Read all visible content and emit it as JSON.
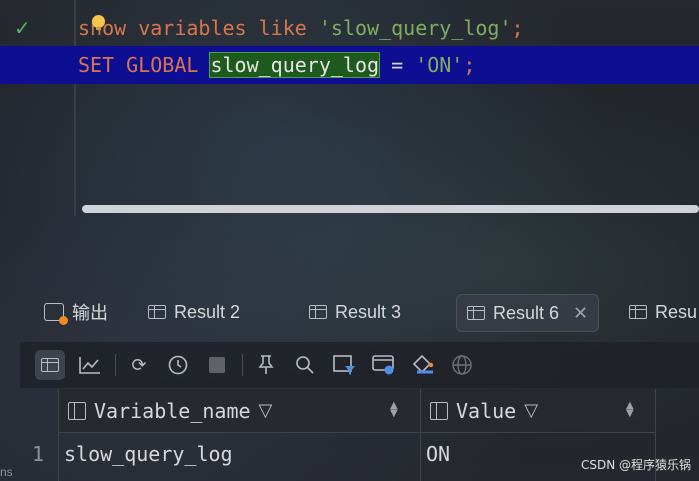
{
  "editor": {
    "line1": {
      "kw1": "show",
      "kw2": "variables",
      "kw3": "like",
      "str": "'slow_query_log'",
      "end": ";"
    },
    "line2": {
      "kw1": "SET",
      "kw2": "GLOBAL",
      "ident": "slow_query_log",
      "op": "=",
      "str": "'ON'",
      "end": ";"
    }
  },
  "tabs": [
    {
      "label": "输出",
      "icon": "output-icon"
    },
    {
      "label": "Result 2",
      "icon": "table-icon"
    },
    {
      "label": "Result 3",
      "icon": "table-icon"
    },
    {
      "label": "Result 6",
      "icon": "table-icon",
      "active": true
    },
    {
      "label": "Resu",
      "icon": "table-icon"
    }
  ],
  "toolbar": {
    "icons": [
      "table-view-icon",
      "chart-icon",
      "refresh-icon",
      "history-icon",
      "stop-icon",
      "pin-icon",
      "search-icon",
      "filter-icon",
      "output-options-icon",
      "export-icon",
      "globe-icon"
    ]
  },
  "grid": {
    "columns": [
      "Variable_name",
      "Value"
    ],
    "rows": [
      {
        "num": "1",
        "cells": [
          "slow_query_log",
          "ON"
        ]
      }
    ]
  },
  "side_fragment": "ns",
  "watermark": "CSDN @程序猿乐锅",
  "colors": {
    "keyword": "#d7764c",
    "string": "#7fae5e",
    "highlight_line": "#0e0e92",
    "check": "#55b35c"
  }
}
